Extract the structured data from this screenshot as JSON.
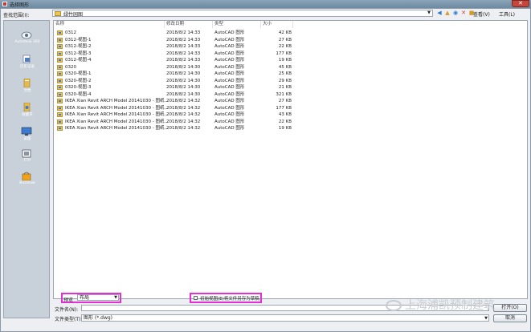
{
  "window": {
    "title": "选择图形",
    "close_glyph": "✕"
  },
  "lookin": {
    "label": "查找范围(I):",
    "value": "绿竹园图"
  },
  "toolbar": {
    "icons": [
      "back-icon",
      "up-folder-icon",
      "search-web-icon",
      "delete-icon",
      "new-folder-icon"
    ],
    "views_label": "查看(V)",
    "tools_label": "工具(L)"
  },
  "places": [
    {
      "label": "Autodesk 360",
      "icon": "cloud-icon"
    },
    {
      "label": "历史记录",
      "icon": "history-icon"
    },
    {
      "label": "文档",
      "icon": "documents-icon"
    },
    {
      "label": "收藏夹",
      "icon": "favorites-icon"
    },
    {
      "label": "桌面",
      "icon": "desktop-icon"
    },
    {
      "label": "FTP",
      "icon": "ftp-icon"
    },
    {
      "label": "Buzzsaw",
      "icon": "buzzsaw-icon"
    }
  ],
  "columns": {
    "name": "名称",
    "date": "修改日期",
    "type": "类型",
    "size": "大小"
  },
  "files": [
    {
      "name": "0312",
      "date": "2018/8/2 14:33",
      "type": "AutoCAD 图形",
      "size": "42 KB"
    },
    {
      "name": "0312-视图-1",
      "date": "2018/8/2 14:33",
      "type": "AutoCAD 图形",
      "size": "27 KB"
    },
    {
      "name": "0312-视图-2",
      "date": "2018/8/2 14:33",
      "type": "AutoCAD 图形",
      "size": "22 KB"
    },
    {
      "name": "0312-视图-3",
      "date": "2018/8/2 14:33",
      "type": "AutoCAD 图形",
      "size": "177 KB"
    },
    {
      "name": "0312-视图-4",
      "date": "2018/8/2 14:33",
      "type": "AutoCAD 图形",
      "size": "19 KB"
    },
    {
      "name": "0320",
      "date": "2018/8/2 14:30",
      "type": "AutoCAD 图形",
      "size": "45 KB"
    },
    {
      "name": "0320-视图-1",
      "date": "2018/8/2 14:30",
      "type": "AutoCAD 图形",
      "size": "25 KB"
    },
    {
      "name": "0320-视图-2",
      "date": "2018/8/2 14:30",
      "type": "AutoCAD 图形",
      "size": "29 KB"
    },
    {
      "name": "0320-视图-3",
      "date": "2018/8/2 14:30",
      "type": "AutoCAD 图形",
      "size": "21 KB"
    },
    {
      "name": "0320-视图-4",
      "date": "2018/8/2 14:30",
      "type": "AutoCAD 图形",
      "size": "321 KB"
    },
    {
      "name": "IKEA Xian Revit ARCH Model 20141030 - 图纸...",
      "date": "2018/8/2 14:32",
      "type": "AutoCAD 图形",
      "size": "27 KB"
    },
    {
      "name": "IKEA Xian Revit ARCH Model 20141030 - 图纸...",
      "date": "2018/8/2 14:32",
      "type": "AutoCAD 图形",
      "size": "177 KB"
    },
    {
      "name": "IKEA Xian Revit ARCH Model 20141030 - 图纸...",
      "date": "2018/8/2 14:32",
      "type": "AutoCAD 图形",
      "size": "43 KB"
    },
    {
      "name": "IKEA Xian Revit ARCH Model 20141030 - 图纸...",
      "date": "2018/8/2 14:32",
      "type": "AutoCAD 图形",
      "size": "22 KB"
    },
    {
      "name": "IKEA Xian Revit ARCH Model 20141030 - 图纸...",
      "date": "2018/8/2 14:32",
      "type": "AutoCAD 图形",
      "size": "19 KB"
    }
  ],
  "viewfile": {
    "label": "预览",
    "value": "布局"
  },
  "checkbox": {
    "label": "初始视图(E)将文件另存为草稿"
  },
  "filename": {
    "label": "文件名(N):",
    "value": ""
  },
  "filetype": {
    "label": "文件类型(T):",
    "value": "图形 (*.dwg)"
  },
  "buttons": {
    "open": "打开(O)",
    "cancel": "取消"
  },
  "watermark": {
    "text": "上海浦凯预制建筑"
  },
  "colors": {
    "highlight": "#e52fd6",
    "places_bg": "#c8d1da"
  }
}
